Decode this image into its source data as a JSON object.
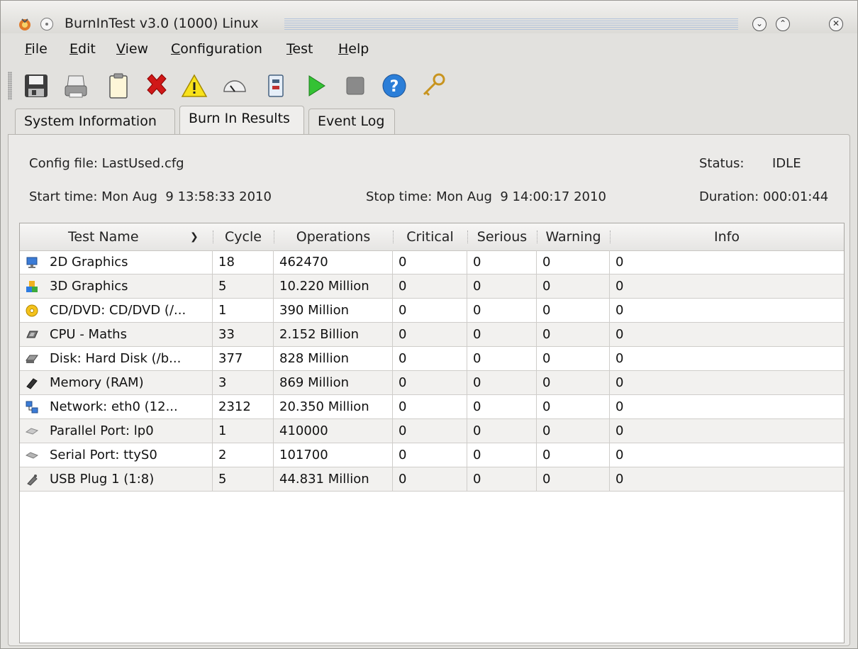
{
  "window": {
    "title": "BurnInTest v3.0 (1000) Linux"
  },
  "menu": [
    {
      "pre": "",
      "acc": "F",
      "post": "ile"
    },
    {
      "pre": "",
      "acc": "E",
      "post": "dit"
    },
    {
      "pre": "",
      "acc": "V",
      "post": "iew"
    },
    {
      "pre": "",
      "acc": "C",
      "post": "onfiguration"
    },
    {
      "pre": "",
      "acc": "T",
      "post": "est"
    },
    {
      "pre": "",
      "acc": "H",
      "post": "elp"
    }
  ],
  "tabs": [
    "System Information",
    "Burn In Results",
    "Event Log"
  ],
  "info": {
    "config": "Config file: LastUsed.cfg",
    "status_label": "Status:",
    "status_value": "IDLE",
    "start": "Start time: Mon Aug  9 13:58:33 2010",
    "stop": "Stop time: Mon Aug  9 14:00:17 2010",
    "duration": "Duration: 000:01:44"
  },
  "table": {
    "columns": [
      "Test Name",
      "Cycle",
      "Operations",
      "Critical",
      "Serious",
      "Warning",
      "Info"
    ],
    "rows": [
      {
        "icon": "monitor-icon",
        "name": "2D Graphics",
        "cycle": "18",
        "ops": "462470",
        "critical": "0",
        "serious": "0",
        "warning": "0",
        "info": "0"
      },
      {
        "icon": "cubes-icon",
        "name": "3D Graphics",
        "cycle": "5",
        "ops": "10.220 Million",
        "critical": "0",
        "serious": "0",
        "warning": "0",
        "info": "0"
      },
      {
        "icon": "cd-icon",
        "name": "CD/DVD: CD/DVD (/...",
        "cycle": "1",
        "ops": "390 Million",
        "critical": "0",
        "serious": "0",
        "warning": "0",
        "info": "0"
      },
      {
        "icon": "cpu-icon",
        "name": "CPU - Maths",
        "cycle": "33",
        "ops": "2.152 Billion",
        "critical": "0",
        "serious": "0",
        "warning": "0",
        "info": "0"
      },
      {
        "icon": "harddisk-icon",
        "name": "Disk: Hard Disk (/b...",
        "cycle": "377",
        "ops": "828 Million",
        "critical": "0",
        "serious": "0",
        "warning": "0",
        "info": "0"
      },
      {
        "icon": "memory-icon",
        "name": "Memory (RAM)",
        "cycle": "3",
        "ops": "869 Million",
        "critical": "0",
        "serious": "0",
        "warning": "0",
        "info": "0"
      },
      {
        "icon": "network-icon",
        "name": "Network: eth0 (12...",
        "cycle": "2312",
        "ops": "20.350 Million",
        "critical": "0",
        "serious": "0",
        "warning": "0",
        "info": "0"
      },
      {
        "icon": "parallel-port-icon",
        "name": "Parallel Port: lp0",
        "cycle": "1",
        "ops": "410000",
        "critical": "0",
        "serious": "0",
        "warning": "0",
        "info": "0"
      },
      {
        "icon": "serial-port-icon",
        "name": "Serial Port: ttyS0",
        "cycle": "2",
        "ops": "101700",
        "critical": "0",
        "serious": "0",
        "warning": "0",
        "info": "0"
      },
      {
        "icon": "usb-plug-icon",
        "name": "USB Plug 1 (1:8)",
        "cycle": "5",
        "ops": "44.831 Million",
        "critical": "0",
        "serious": "0",
        "warning": "0",
        "info": "0"
      }
    ]
  },
  "toolbar_icons": [
    "save-icon",
    "printer-icon",
    "clipboard-icon",
    "delete-icon",
    "warning-icon",
    "speedometer-icon",
    "checklist-icon",
    "play-icon",
    "stop-icon",
    "help-icon",
    "key-icon"
  ]
}
